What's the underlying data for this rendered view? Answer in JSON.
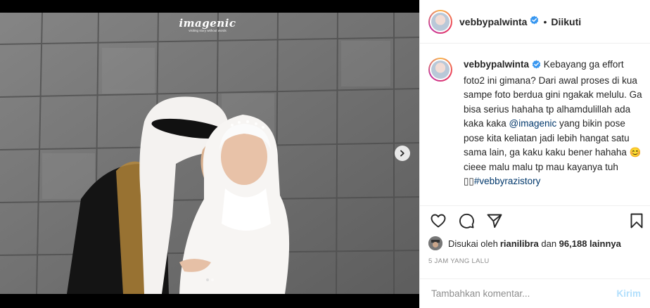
{
  "post": {
    "watermark": {
      "main": "imagenic",
      "sub": "visiting story without words"
    },
    "carousel": {
      "total": 2,
      "active": 1,
      "next_icon": "chevron-right-icon"
    }
  },
  "header": {
    "username": "vebbypalwinta",
    "separator": "•",
    "follow_label": "Diikuti",
    "verified_icon": "verified-badge-icon"
  },
  "caption": {
    "username": "vebbypalwinta",
    "text_1": " Kebayang ga effort foto2 ini gimana? Dari awal proses di kua sampe foto berdua gini ngakak melulu. Ga bisa serius hahaha tp alhamdulillah ada kaka kaka ",
    "mention": "@imagenic",
    "text_2": " yang bikin pose pose kita keliatan jadi lebih hangat satu sama lain, ga kaku kaku bener hahaha 😊 cieee malu malu tp mau kayanya tuh ",
    "boxes": "▯▯",
    "hashtag": "#vebbyrazistory"
  },
  "actions": {
    "like_icon": "heart-icon",
    "comment_icon": "comment-icon",
    "share_icon": "share-icon",
    "save_icon": "bookmark-icon"
  },
  "likes": {
    "prefix": "Disukai oleh ",
    "user": "rianilibra",
    "middle": " dan ",
    "count": "96,188 lainnya"
  },
  "timestamp": "5 JAM YANG LALU",
  "comment_box": {
    "placeholder": "Tambahkan komentar...",
    "post_label": "Kirim"
  },
  "colors": {
    "link": "#00376b",
    "verified": "#3897f0",
    "post_disabled": "#b2dffc",
    "muted": "#8e8e8e"
  }
}
